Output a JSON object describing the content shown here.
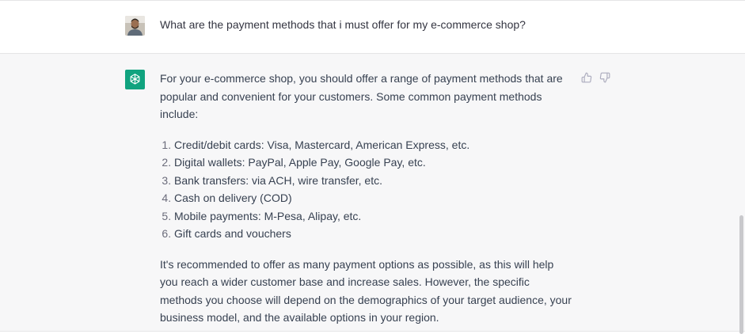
{
  "conversation": {
    "user_message": "What are the payment methods that i must offer for my e-commerce shop?",
    "assistant": {
      "intro": "For your e-commerce shop, you should offer a range of payment methods that are popular and convenient for your customers. Some common payment methods include:",
      "items": [
        "Credit/debit cards: Visa, Mastercard, American Express, etc.",
        "Digital wallets: PayPal, Apple Pay, Google Pay, etc.",
        "Bank transfers: via ACH, wire transfer, etc.",
        "Cash on delivery (COD)",
        "Mobile payments: M-Pesa, Alipay, etc.",
        "Gift cards and vouchers"
      ],
      "closing": "It's recommended to offer as many payment options as possible, as this will help you reach a wider customer base and increase sales. However, the specific methods you choose will depend on the demographics of your target audience, your business model, and the available options in your region."
    }
  },
  "icons": {
    "user_avatar": "user-photo-avatar",
    "assistant_avatar": "openai-logo-icon",
    "thumbs_up": "thumbs-up-icon",
    "thumbs_down": "thumbs-down-icon"
  },
  "colors": {
    "assistant_bg": "#f7f7f8",
    "brand_green": "#10a37f",
    "text": "#374151"
  }
}
